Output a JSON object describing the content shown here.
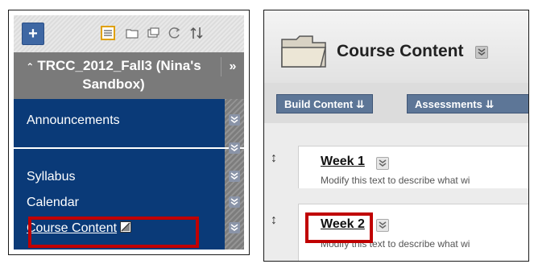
{
  "left_panel": {
    "course_title": "TRCC_2012_Fall3 (Nina's Sandbox)",
    "nav_items": [
      "Announcements",
      "Syllabus",
      "Calendar",
      "Course Content"
    ]
  },
  "right_panel": {
    "page_title": "Course Content",
    "toolbar": [
      "Build Content",
      "Assessments"
    ],
    "items": [
      {
        "title": "Week 1",
        "description": "Modify this text to describe what wi"
      },
      {
        "title": "Week 2",
        "description": "Modify this text to describe what wi"
      }
    ]
  },
  "colors": {
    "nav_background": "#0a3a78",
    "highlight": "#c00000",
    "toolbar_button": "#5d7697"
  }
}
